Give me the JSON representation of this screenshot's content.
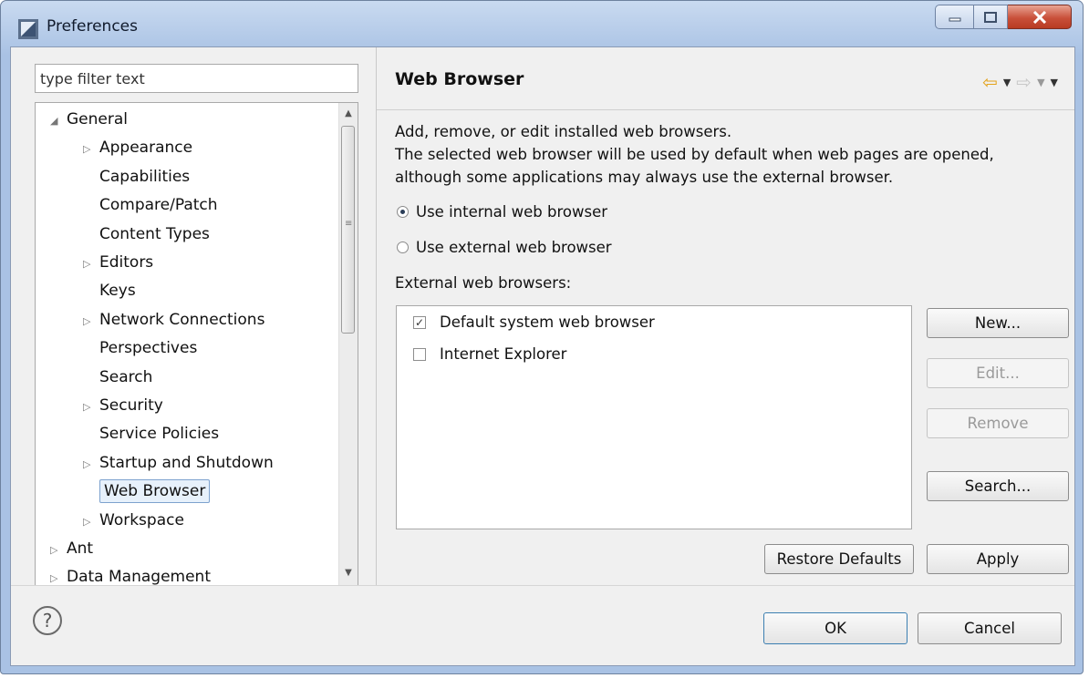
{
  "window": {
    "title": "Preferences"
  },
  "filter": {
    "placeholder": "type filter text"
  },
  "tree": {
    "items": [
      {
        "label": "General",
        "expander": "◢",
        "level": 0
      },
      {
        "label": "Appearance",
        "expander": "▷",
        "level": 1
      },
      {
        "label": "Capabilities",
        "expander": "",
        "level": 1
      },
      {
        "label": "Compare/Patch",
        "expander": "",
        "level": 1
      },
      {
        "label": "Content Types",
        "expander": "",
        "level": 1
      },
      {
        "label": "Editors",
        "expander": "▷",
        "level": 1
      },
      {
        "label": "Keys",
        "expander": "",
        "level": 1
      },
      {
        "label": "Network Connections",
        "expander": "▷",
        "level": 1
      },
      {
        "label": "Perspectives",
        "expander": "",
        "level": 1
      },
      {
        "label": "Search",
        "expander": "",
        "level": 1
      },
      {
        "label": "Security",
        "expander": "▷",
        "level": 1
      },
      {
        "label": "Service Policies",
        "expander": "",
        "level": 1
      },
      {
        "label": "Startup and Shutdown",
        "expander": "▷",
        "level": 1
      },
      {
        "label": "Web Browser",
        "expander": "",
        "level": 1,
        "selected": true
      },
      {
        "label": "Workspace",
        "expander": "▷",
        "level": 1
      },
      {
        "label": "Ant",
        "expander": "▷",
        "level": 0
      },
      {
        "label": "Data Management",
        "expander": "▷",
        "level": 0
      }
    ]
  },
  "page": {
    "title": "Web Browser",
    "description": [
      "Add, remove, or edit installed web browsers.",
      "The selected web browser will be used by default when web pages are opened,",
      "although some applications may always use the external browser."
    ],
    "radio_internal": "Use internal web browser",
    "radio_external": "Use external web browser",
    "selected_radio": "internal",
    "external_label": "External web browsers:",
    "browsers": [
      {
        "label": "Default system web browser",
        "checked": true
      },
      {
        "label": "Internet Explorer",
        "checked": false
      }
    ],
    "buttons": {
      "new": "New...",
      "edit": "Edit...",
      "remove": "Remove",
      "search": "Search...",
      "restore_defaults": "Restore Defaults",
      "apply": "Apply"
    }
  },
  "footer": {
    "ok": "OK",
    "cancel": "Cancel",
    "help_glyph": "?"
  },
  "colors": {
    "accent_arrow": "#e3a21a",
    "selection_bg": "#e7f1fb",
    "selection_border": "#7da2ce"
  }
}
